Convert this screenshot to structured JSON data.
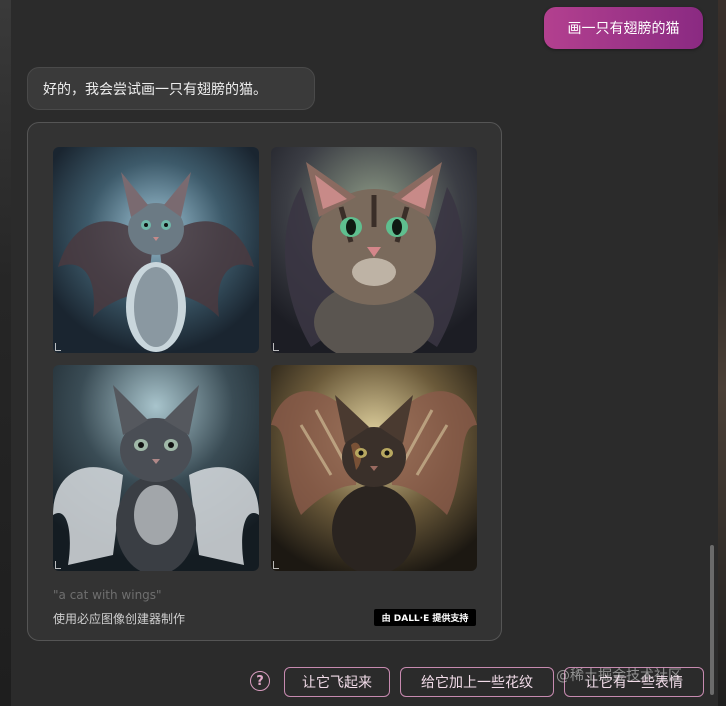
{
  "user_message": "画一只有翅膀的猫",
  "bot_reply": "好的，我会尝试画一只有翅膀的猫。",
  "image_card": {
    "prompt": "\"a cat with wings\"",
    "made_with": "使用必应图像创建器制作",
    "badge": "由 DALL·E 提供支持",
    "images": [
      {
        "name": "cat-image-1",
        "icon": "cat-with-wings-image"
      },
      {
        "name": "cat-image-2",
        "icon": "cat-with-wings-image"
      },
      {
        "name": "cat-image-3",
        "icon": "cat-with-wings-image"
      },
      {
        "name": "cat-image-4",
        "icon": "cat-with-wings-image"
      }
    ]
  },
  "suggestions": {
    "help_icon": "question-circle-icon",
    "chips": [
      "让它飞起来",
      "给它加上一些花纹",
      "让它有一些表情"
    ]
  },
  "watermark": "@稀土掘金技术社区",
  "colors": {
    "background": "#2b2b2b",
    "user_bubble_start": "#b3408f",
    "user_bubble_end": "#8a2a82",
    "chip_border": "#c78ab0"
  }
}
